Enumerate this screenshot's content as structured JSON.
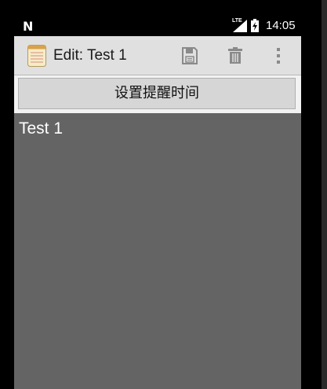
{
  "status_bar": {
    "notification_icon": "n-icon",
    "network_label": "LTE",
    "signal_icon": "signal-icon",
    "battery_icon": "battery-charging-icon",
    "time": "14:05"
  },
  "action_bar": {
    "app_icon": "notepad-icon",
    "title": "Edit: Test 1",
    "save_icon": "save-icon",
    "delete_icon": "trash-icon",
    "overflow_icon": "more-vert-icon"
  },
  "reminder": {
    "button_label": "设置提醒时间"
  },
  "editor": {
    "note_text": "Test 1"
  },
  "colors": {
    "status_bar": "#000000",
    "action_bar": "#e0e0e0",
    "editor_background": "#646464",
    "icon_gray": "#8a8a8a"
  }
}
